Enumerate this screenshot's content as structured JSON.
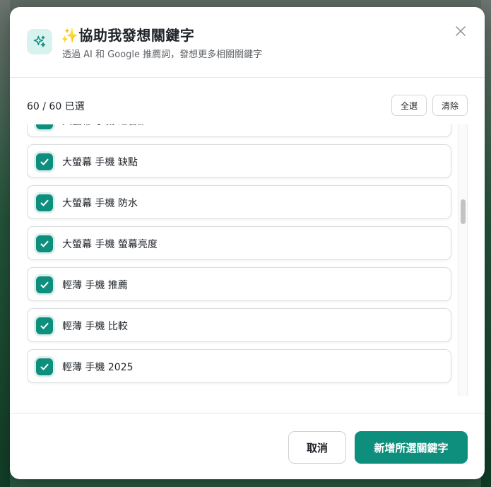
{
  "dialog": {
    "title": "✨協助我發想關鍵字",
    "subtitle": "透過 AI 和 Google 推薦詞，發想更多相關關鍵字",
    "header_icon": "sparkles-icon",
    "close_icon": "close-icon"
  },
  "toolbar": {
    "selected_count_text": "60 / 60 已選",
    "select_all_label": "全選",
    "clear_label": "清除"
  },
  "keywords": [
    {
      "label": "大螢幕 手機 適合誰",
      "checked": true
    },
    {
      "label": "大螢幕 手機 缺點",
      "checked": true
    },
    {
      "label": "大螢幕 手機 防水",
      "checked": true
    },
    {
      "label": "大螢幕 手機 螢幕亮度",
      "checked": true
    },
    {
      "label": "輕薄 手機 推薦",
      "checked": true
    },
    {
      "label": "輕薄 手機 比較",
      "checked": true
    },
    {
      "label": "輕薄 手機 2025",
      "checked": true
    }
  ],
  "footer": {
    "cancel_label": "取消",
    "add_label": "新增所選關鍵字"
  },
  "colors": {
    "accent": "#0e8f7d",
    "icon_bg": "#d8f3ef"
  }
}
